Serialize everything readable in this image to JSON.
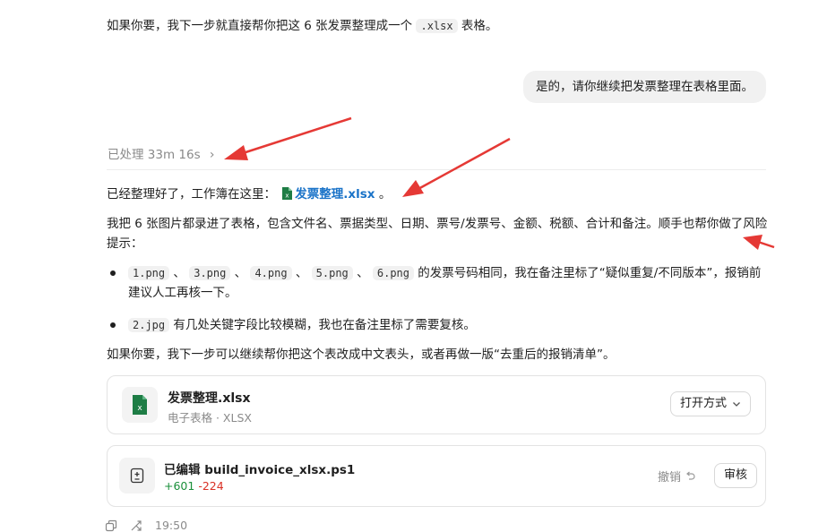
{
  "top_para": {
    "text_before": "如果你要，我下一步就直接帮你把这 6 张发票整理成一个 ",
    "code": ".xlsx",
    "text_after": " 表格。"
  },
  "user_bubble": "是的，请你继续把发票整理在表格里面。",
  "processed": {
    "label": "已处理 33m 16s",
    "chevron": "›"
  },
  "answer": {
    "intro_before": "已经整理好了，工作簿在这里：",
    "file_link": "发票整理.xlsx",
    "intro_after": "。",
    "para2": "我把 6 张图片都录进了表格，包含文件名、票据类型、日期、票号/发票号、金额、税额、合计和备注。顺手也帮你做了风险提示：",
    "bullet1": {
      "files": [
        "1.png",
        "3.png",
        "4.png",
        "5.png",
        "6.png"
      ],
      "sep": " 、 ",
      "text": " 的发票号码相同，我在备注里标了“疑似重复/不同版本”，报销前建议人工再核一下。"
    },
    "bullet2": {
      "file": "2.jpg",
      "text": " 有几处关键字段比较模糊，我也在备注里标了需要复核。"
    },
    "closing": "如果你要，我下一步可以继续帮你把这个表改成中文表头，或者再做一版“去重后的报销清单”。"
  },
  "file_card": {
    "name": "发票整理.xlsx",
    "subtitle": "电子表格 · XLSX",
    "open_with": "打开方式",
    "icon_letter": "x"
  },
  "edit_card": {
    "title": "已编辑 build_invoice_xlsx.ps1",
    "added": "+601",
    "removed": "-224",
    "undo": "撤销",
    "review": "审核"
  },
  "footer": {
    "time": "19:50"
  },
  "colors": {
    "accent_link": "#1a73c8",
    "added": "#1a8f3a",
    "removed": "#d93025",
    "arrow": "#e53935",
    "excel_green": "#1e7d45"
  }
}
